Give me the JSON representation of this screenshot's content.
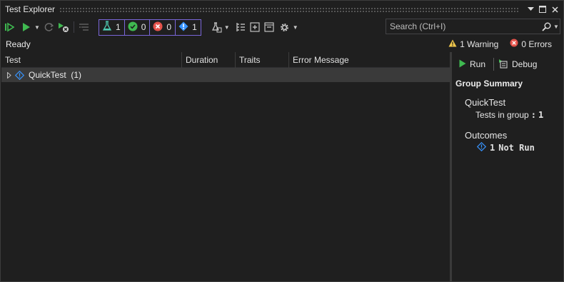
{
  "window": {
    "title": "Test Explorer",
    "controls": {
      "dropdown_icon": "caret-down-icon",
      "maximize_icon": "maximize-icon",
      "close_icon": "close-icon"
    }
  },
  "toolbar": {
    "buttons": [
      {
        "name": "run-all-tests",
        "icon": "run-all-icon"
      },
      {
        "name": "run",
        "icon": "play-icon"
      },
      {
        "name": "repeat-last-run",
        "icon": "repeat-icon"
      },
      {
        "name": "cancel",
        "icon": "cancel-icon"
      },
      {
        "name": "show-output",
        "icon": "output-icon"
      }
    ],
    "filters": [
      {
        "name": "total-tests",
        "icon": "flask-icon",
        "count": "1"
      },
      {
        "name": "passed-tests",
        "icon": "check-icon",
        "count": "0",
        "color": "#3fb950"
      },
      {
        "name": "failed-tests",
        "icon": "error-icon",
        "count": "0",
        "color": "#e5534b"
      },
      {
        "name": "not-run-tests",
        "icon": "info-icon",
        "count": "1",
        "color": "#3794ff"
      }
    ],
    "search": {
      "placeholder": "Search (Ctrl+I)"
    }
  },
  "status": {
    "text": "Ready",
    "warnings": "1 Warning",
    "errors": "0 Errors"
  },
  "grid": {
    "columns": [
      "Test",
      "Duration",
      "Traits",
      "Error Message"
    ],
    "rows": [
      {
        "label": "QuickTest  (1)",
        "icon": "not-run-icon"
      }
    ]
  },
  "details": {
    "run_label": "Run",
    "debug_label": "Debug",
    "group_summary_title": "Group Summary",
    "group_name": "QuickTest",
    "tests_in_group_label": "Tests in group",
    "tests_in_group_sep": ":",
    "tests_in_group_value": "1",
    "outcomes_title": "Outcomes",
    "outcome_count": "1",
    "outcome_label": "Not Run"
  },
  "colors": {
    "accent_border": "#7a66d9",
    "pass": "#3fb950",
    "fail": "#e5534b",
    "info": "#3794ff",
    "warning": "#f2c94c",
    "background": "#1f1f1f"
  }
}
